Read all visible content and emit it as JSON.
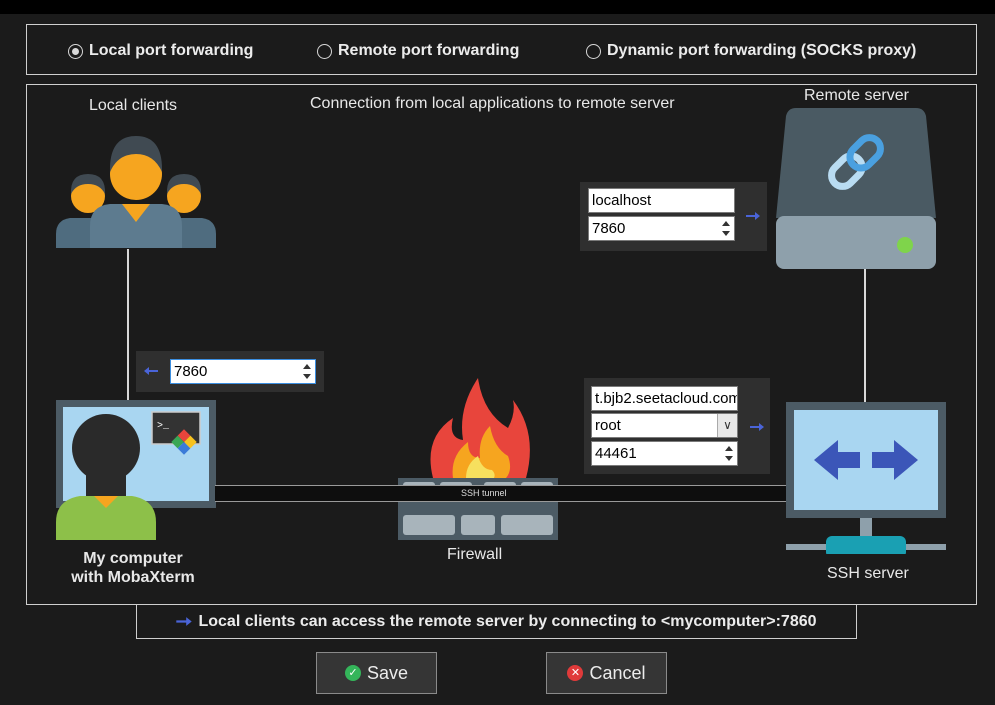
{
  "modes": [
    {
      "label": "Local port forwarding",
      "selected": true
    },
    {
      "label": "Remote port forwarding",
      "selected": false
    },
    {
      "label": "Dynamic port forwarding (SOCKS proxy)",
      "selected": false
    }
  ],
  "diagram": {
    "caption": "Connection from local applications to remote server",
    "local_clients_label": "Local clients",
    "remote_server_label": "Remote server",
    "my_computer_label_1": "My computer",
    "my_computer_label_2": "with MobaXterm",
    "firewall_label": "Firewall",
    "ssh_server_label": "SSH server",
    "tunnel_label": "SSH tunnel"
  },
  "remote": {
    "host_value": "localhost",
    "port_value": "7860"
  },
  "local": {
    "port_value": "7860"
  },
  "ssh": {
    "server_value": "t.bjb2.seetacloud.com",
    "user_value": "root",
    "port_value": "44461"
  },
  "note": "Local clients can access the remote server by connecting to <mycomputer>:7860",
  "buttons": {
    "save_label": "Save",
    "cancel_label": "Cancel"
  },
  "colors": {
    "arrow": "#4a64d8",
    "save_icon": "#34b55a",
    "cancel_icon": "#e03a3a"
  }
}
